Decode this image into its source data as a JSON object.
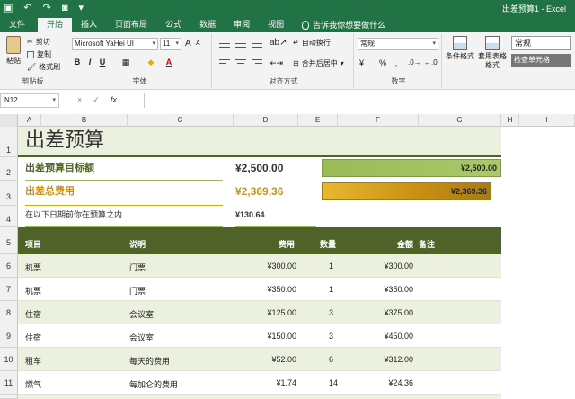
{
  "window": {
    "title": "出差预算1 - Excel"
  },
  "tabs": [
    "文件",
    "开始",
    "插入",
    "页面布局",
    "公式",
    "数据",
    "审阅",
    "视图",
    "告诉我你想要做什么"
  ],
  "ribbon": {
    "clipboard": {
      "paste": "粘贴",
      "cut": "剪切",
      "copy": "复制",
      "format_painter": "格式刷",
      "group": "剪贴板"
    },
    "font": {
      "name": "Microsoft YaHei UI",
      "size": "11",
      "grow": "A",
      "shrink": "A",
      "bold": "B",
      "italic": "I",
      "underline": "U",
      "group": "字体"
    },
    "alignment": {
      "wrap": "自动换行",
      "merge": "合并后居中",
      "group": "对齐方式"
    },
    "number": {
      "format": "常规",
      "currency": "¥",
      "percent": "%",
      "comma": "‚",
      "group": "数字"
    },
    "styles": {
      "conditional": "条件格式",
      "table": "套用表格格式",
      "normal": "常规",
      "check": "检查单元格"
    }
  },
  "formula_bar": {
    "name_box": "N12",
    "cancel": "×",
    "enter": "✓",
    "fx": "fx",
    "formula": ""
  },
  "columns": [
    "A",
    "B",
    "C",
    "D",
    "E",
    "F",
    "G",
    "H",
    "I"
  ],
  "rows": [
    {
      "n": "1"
    },
    {
      "n": "2"
    },
    {
      "n": "3"
    },
    {
      "n": "4"
    },
    {
      "n": "5"
    },
    {
      "n": "6"
    },
    {
      "n": "7"
    },
    {
      "n": "8"
    },
    {
      "n": "9"
    },
    {
      "n": "10"
    },
    {
      "n": "11"
    }
  ],
  "sheet": {
    "title": "出差预算",
    "target_label": "出差预算目标额",
    "target_value": "¥2,500.00",
    "target_bar": "¥2,500.00",
    "total_label": "出差总费用",
    "total_value": "¥2,369.36",
    "total_bar": "¥2,369.36",
    "remaining_label": "在以下日期前你在预算之内",
    "remaining_value": "¥130.64",
    "headers": {
      "item": "项目",
      "desc": "说明",
      "cost": "费用",
      "qty": "数量",
      "amount": "金额",
      "note": "备注"
    },
    "items": [
      {
        "item": "机票",
        "desc": "门票",
        "cost": "¥300.00",
        "qty": "1",
        "amount": "¥300.00"
      },
      {
        "item": "机票",
        "desc": "门票",
        "cost": "¥350.00",
        "qty": "1",
        "amount": "¥350.00"
      },
      {
        "item": "住宿",
        "desc": "会议室",
        "cost": "¥125.00",
        "qty": "3",
        "amount": "¥375.00"
      },
      {
        "item": "住宿",
        "desc": "会议室",
        "cost": "¥150.00",
        "qty": "3",
        "amount": "¥450.00"
      },
      {
        "item": "租车",
        "desc": "每天的费用",
        "cost": "¥52.00",
        "qty": "6",
        "amount": "¥312.00"
      },
      {
        "item": "燃气",
        "desc": "每加仑的费用",
        "cost": "¥1.74",
        "qty": "14",
        "amount": "¥24.36"
      }
    ]
  },
  "colors": {
    "ribbon_green": "#217346",
    "header_band": "#4f6228",
    "band_light": "#ebf1de",
    "bar_green": "#9bbb59",
    "bar_gold": "#d9a022"
  }
}
